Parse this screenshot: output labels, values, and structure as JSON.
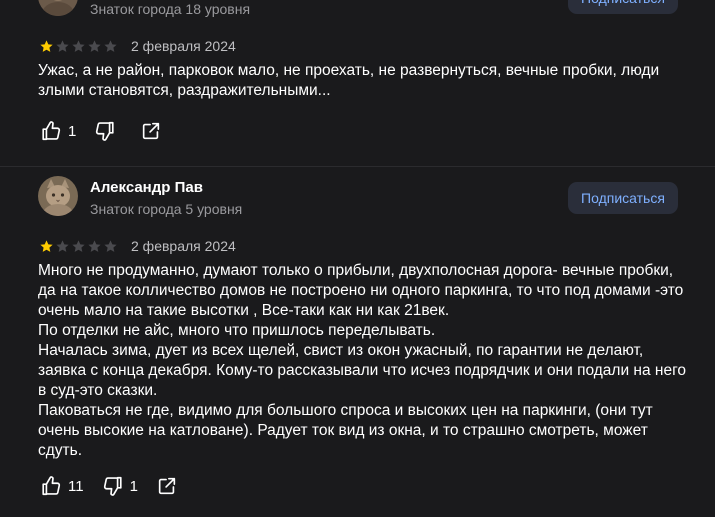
{
  "reviews": [
    {
      "author": "",
      "level": "Знаток города 18 уровня",
      "subscribe_label": "Подписаться",
      "rating": 1,
      "date": "2 февраля 2024",
      "paragraphs": [
        "Ужас, а не район, парковок мало, не проехать, не развернуться, вечные пробки, люди злыми становятся, раздражительными..."
      ],
      "likes": "1",
      "dislikes": ""
    },
    {
      "author": "Александр Пав",
      "level": "Знаток города 5 уровня",
      "subscribe_label": "Подписаться",
      "rating": 1,
      "date": "2 февраля 2024",
      "paragraphs": [
        "Много не продуманно, думают только о прибыли, двухполосная дорога- вечные пробки, да на такое колличество домов не построено ни одного паркинга, то что под домами -это очень мало на такие высотки , Все-таки как ни как 21век.",
        "По отделки не айс, много что пришлось переделывать.",
        "Началась зима, дует из всех щелей, свист из окон ужасный, по гарантии не делают, заявка с конца декабря. Кому-то рассказывали что исчез подрядчик и они подали на него в суд-это сказки.",
        "Паковаться не где, видимо для большого спроса и высоких цен на паркинги, (они тут очень высокие на катловане). Радует ток вид из окна, и то страшно смотреть, может сдуть."
      ],
      "likes": "11",
      "dislikes": "1"
    }
  ],
  "colors": {
    "background": "#1a1a1c",
    "star_filled": "#ffcc00",
    "star_empty": "#4a4a4e",
    "subscribe_bg": "#2a2e3a",
    "subscribe_text": "#7fb0ff",
    "muted_text": "#9a9a9e"
  },
  "icons": {
    "like": "thumbs-up-icon",
    "dislike": "thumbs-down-icon",
    "share": "share-icon",
    "star": "star-icon"
  }
}
